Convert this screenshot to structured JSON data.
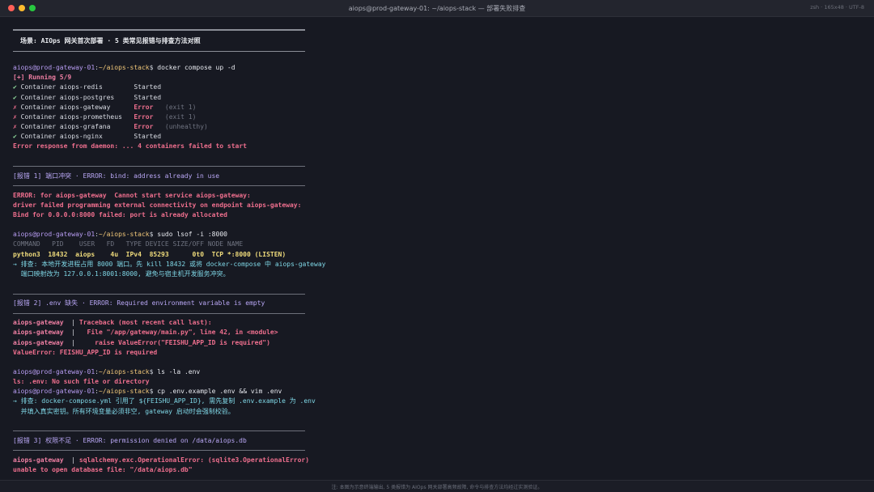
{
  "window": {
    "title": "aiops@prod-gateway-01: ~/aiops-stack — 部署失败排查",
    "right_info": "zsh · 165x48 · UTF-8"
  },
  "banner": "场景: AIOps 网关首次部署 · 5 类常见报错与排查方法对照",
  "prompt": {
    "user": "aiops@prod-gateway-01",
    "sep": ":",
    "path": "~/aiops-stack",
    "dollar": "$ "
  },
  "compose": {
    "command": "docker compose up -d",
    "running": "[+] Running 5/9",
    "containers": [
      {
        "mark": "✔",
        "name": "Container aiops-redis        ",
        "status": "Started",
        "note": ""
      },
      {
        "mark": "✔",
        "name": "Container aiops-postgres     ",
        "status": "Started",
        "note": ""
      },
      {
        "mark": "✗",
        "name": "Container aiops-gateway      ",
        "status": "Error",
        "note": "(exit 1)"
      },
      {
        "mark": "✗",
        "name": "Container aiops-prometheus   ",
        "status": "Error",
        "note": "(exit 1)"
      },
      {
        "mark": "✗",
        "name": "Container aiops-grafana      ",
        "status": "Error",
        "note": "(unhealthy)"
      },
      {
        "mark": "✔",
        "name": "Container aiops-nginx        ",
        "status": "Started",
        "note": ""
      }
    ],
    "error_summary": "Error response from daemon: ... 4 containers failed to start"
  },
  "error1": {
    "header": "[报错 1] 端口冲突 · ERROR: bind: address already in use",
    "lines": [
      "ERROR: for aiops-gateway  Cannot start service aiops-gateway:",
      "driver failed programming external connectivity on endpoint aiops-gateway:",
      "Bind for 0.0.0.0:8000 failed: port is already allocated"
    ],
    "command": "sudo lsof -i :8000",
    "lsof_header": "COMMAND   PID    USER   FD   TYPE DEVICE SIZE/OFF NODE NAME",
    "lsof_row": "python3  18432  aiops    4u  IPv4  85293      0t0  TCP *:8000 (LISTEN)",
    "fix_1": "→ 排查: 本地开发进程占用 8000 端口。先 kill 18432 或将 docker-compose 中 aiops-gateway",
    "fix_2": "  端口映射改为 127.0.0.1:8001:8000, 避免与宿主机开发服务冲突。"
  },
  "error2": {
    "header": "[报错 2] .env 缺失 · ERROR: Required environment variable is empty",
    "trace": [
      {
        "svc": "aiops-gateway",
        "sep": "  | ",
        "msg": "Traceback (most recent call last):"
      },
      {
        "svc": "aiops-gateway",
        "sep": "  |   ",
        "msg": "File \"/app/gateway/main.py\", line 42, in <module>"
      },
      {
        "svc": "aiops-gateway",
        "sep": "  |     ",
        "msg": "raise ValueError(\"FEISHU_APP_ID is required\")"
      }
    ],
    "value_error": "ValueError: FEISHU_APP_ID is required",
    "command_ls": "ls -la .env",
    "ls_out": "ls: .env: No such file or directory",
    "command_cp": "cp .env.example .env && vim .env",
    "fix_1": "→ 排查: docker-compose.yml 引用了 ${FEISHU_APP_ID}, 需先复制 .env.example 为 .env",
    "fix_2": "  并填入真实密钥。所有环境变量必须非空, gateway 启动时会强制校验。"
  },
  "error3": {
    "header": "[报错 3] 权限不足 · ERROR: permission denied on /data/aiops.db",
    "line_svc": "aiops-gateway",
    "line_sep": "  | ",
    "line_msg": "sqlalchemy.exc.OperationalError: (sqlite3.OperationalError)",
    "line2": "unable to open database file: \"/data/aiops.db\""
  },
  "footer": "注: 本图为示意终端输出, 5 类报错为 AIOps 网关部署高频故障, 命令与排查方法均经过实测验证。",
  "colors": {
    "background": "#171922",
    "accent_purple": "#b79cf2",
    "path_yellow": "#f2c879",
    "error_pink": "#ef7fa3",
    "ok_green": "#8fd99b"
  }
}
